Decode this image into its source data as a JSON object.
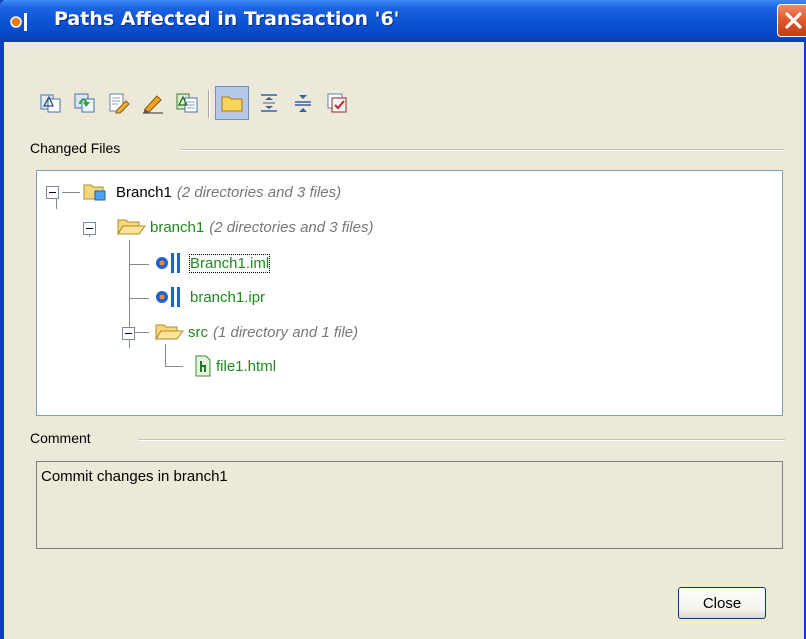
{
  "window": {
    "title": "Paths Affected in Transaction '6'"
  },
  "toolbar": {
    "buttons": [
      {
        "icon": "compare-icon"
      },
      {
        "icon": "refresh-icon"
      },
      {
        "icon": "edit-icon"
      },
      {
        "icon": "pencil-icon"
      },
      {
        "icon": "compare-with-icon"
      },
      {
        "icon": "folder-icon",
        "active": true
      },
      {
        "icon": "expand-all-icon"
      },
      {
        "icon": "collapse-all-icon"
      },
      {
        "icon": "checklist-icon"
      }
    ]
  },
  "changed_files": {
    "label": "Changed Files",
    "tree": [
      {
        "name": "Branch1",
        "meta": "(2 directories and 3 files)",
        "icon": "repository-folder-icon",
        "color": "#000000"
      },
      {
        "name": "branch1",
        "meta": "(2 directories and 3 files)",
        "icon": "open-folder-icon",
        "color": "#1f8a1f"
      },
      {
        "name": "Branch1.iml",
        "meta": "",
        "icon": "idea-module-icon",
        "color": "#1f8a1f"
      },
      {
        "name": "branch1.ipr",
        "meta": "",
        "icon": "idea-project-icon",
        "color": "#1f8a1f"
      },
      {
        "name": "src",
        "meta": "(1 directory and 1 file)",
        "icon": "open-folder-icon",
        "color": "#1f8a1f"
      },
      {
        "name": "file1.html",
        "meta": "",
        "icon": "html-file-icon",
        "color": "#1f8a1f"
      }
    ]
  },
  "comment": {
    "label": "Comment",
    "text": "Commit changes in branch1"
  },
  "buttons": {
    "close_label": "Close"
  }
}
